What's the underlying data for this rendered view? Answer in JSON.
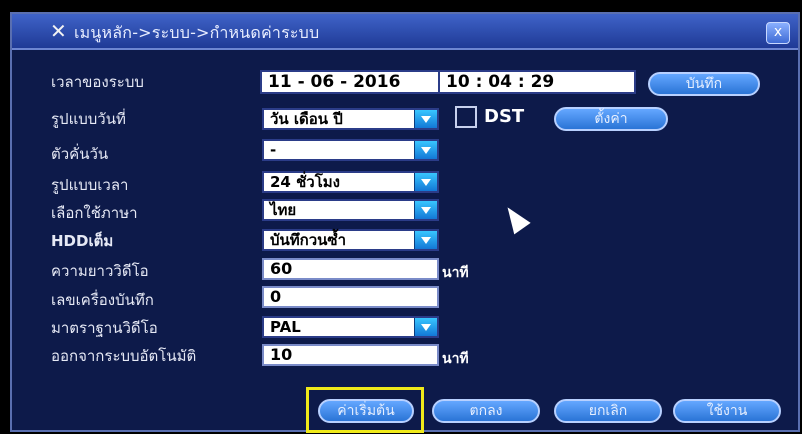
{
  "window": {
    "title": "เมนูหลัก->ระบบ->กำหนดค่าระบบ",
    "close_label": "x"
  },
  "form": {
    "system_time": {
      "label": "เวลาของระบบ",
      "date_value": "11 - 06 - 2016",
      "time_value": "10 : 04 : 29"
    },
    "date_format": {
      "label": "รูปแบบวันที่",
      "value": "วัน เดือน ปี"
    },
    "date_separator": {
      "label": "ตัวคั่นวัน",
      "value": "-"
    },
    "time_format": {
      "label": "รูปแบบเวลา",
      "value": "24 ชั่วโมง"
    },
    "language": {
      "label": "เลือกใช้ภาษา",
      "value": "ไทย"
    },
    "hdd_full": {
      "label": "HDDเต็ม",
      "value": "บันทึกวนซ้ำ"
    },
    "video_length": {
      "label": "ความยาววิดีโอ",
      "value": "60",
      "unit": "นาที"
    },
    "recorder_no": {
      "label": "เลขเครื่องบันทึก",
      "value": "0"
    },
    "video_standard": {
      "label": "มาตราฐานวิดีโอ",
      "value": "PAL"
    },
    "auto_logout": {
      "label": "ออกจากระบบอัตโนมัติ",
      "value": "10",
      "unit": "นาที"
    }
  },
  "buttons": {
    "save": "บันทึก",
    "dst_setup": "ตั้งค่า",
    "default": "ค่าเริ่มต้น",
    "ok": "ตกลง",
    "cancel": "ยกเลิก",
    "apply": "ใช้งาน"
  },
  "dst": {
    "label": "DST",
    "checked": false
  },
  "colors": {
    "panel_bg": "#0d1a4a",
    "accent": "#2a74d6",
    "highlight": "#f0ea1a"
  }
}
